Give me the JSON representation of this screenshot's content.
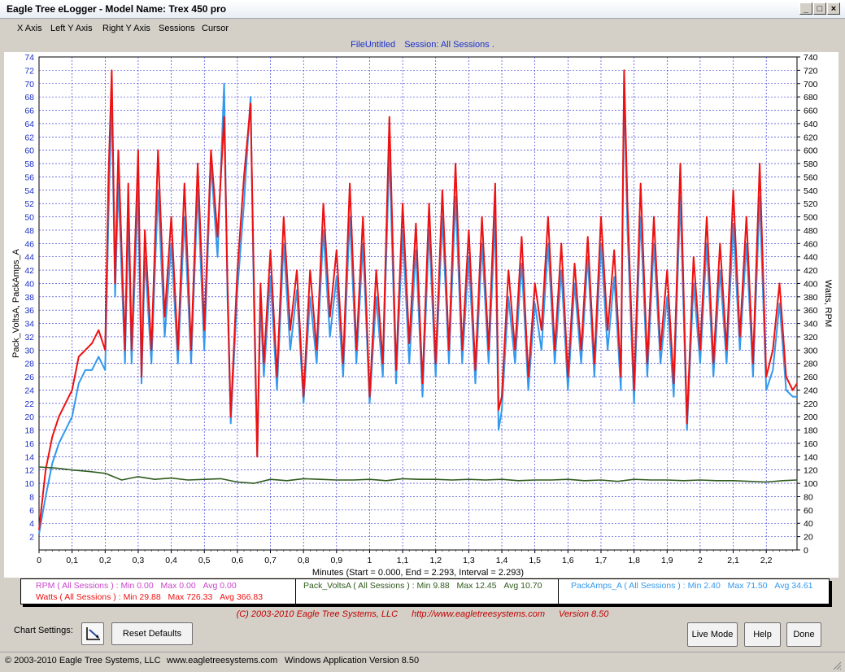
{
  "window": {
    "title": "Eagle Tree eLogger - Model Name: Trex 450 pro"
  },
  "menu": [
    "X Axis",
    "Left Y Axis",
    "Right Y Axis",
    "Sessions",
    "Cursor"
  ],
  "header": {
    "file": "FileUntitled",
    "session": "Session: All Sessions ."
  },
  "legend": {
    "rpm": {
      "label": "RPM ( All Sessions ) :",
      "min": "Min 0.00",
      "max": "Max 0.00",
      "avg": "Avg 0.00"
    },
    "watts": {
      "label": "Watts ( All Sessions ) :",
      "min": "Min 29.88",
      "max": "Max 726.33",
      "avg": "Avg 366.83"
    },
    "volts": {
      "label": "Pack_VoltsA ( All Sessions ) :",
      "min": "Min 9.88",
      "max": "Max 12.45",
      "avg": "Avg 10.70"
    },
    "amps": {
      "label": "PackAmps_A ( All Sessions ) :",
      "min": "Min 2.40",
      "max": "Max 71.50",
      "avg": "Avg 34.61"
    }
  },
  "footer": {
    "copyright": "(C) 2003-2010 Eagle Tree Systems, LLC",
    "url": "http://www.eagletreesystems.com",
    "version": "Version 8.50"
  },
  "controls": {
    "chart_settings": "Chart Settings:",
    "reset": "Reset Defaults",
    "live": "Live Mode",
    "help": "Help",
    "done": "Done"
  },
  "statusbar": {
    "company": "© 2003-2010 Eagle Tree Systems, LLC",
    "site": "www.eagletreesystems.com",
    "app": "Windows Application Version 8.50"
  },
  "colors": {
    "rpm": "#cc44cc",
    "watts": "#ee1111",
    "volts": "#2e5a1c",
    "amps": "#3399ee",
    "grid": "#1f1fd0",
    "axis_text": "#1a2fc8"
  },
  "chart_data": {
    "type": "line",
    "xlabel": "Minutes (Start = 0.000,  End = 2.293,  Interval =  2.293)",
    "ylabel_left": "Pack_VoltsA, PackAmps_A",
    "ylabel_right": "Watts, RPM",
    "xlim": [
      0,
      2.293
    ],
    "ylim_left": [
      0,
      74
    ],
    "ylim_right": [
      0,
      740
    ],
    "x_ticks": [
      "0",
      "0,1",
      "0,2",
      "0,3",
      "0,4",
      "0,5",
      "0,6",
      "0,7",
      "0,8",
      "0,9",
      "1",
      "1,1",
      "1,2",
      "1,3",
      "1,4",
      "1,5",
      "1,6",
      "1,7",
      "1,8",
      "1,9",
      "2",
      "2,1",
      "2,2"
    ],
    "grid": true,
    "series": [
      {
        "name": "Watts",
        "axis": "right",
        "x": [
          0,
          0.02,
          0.04,
          0.06,
          0.08,
          0.1,
          0.12,
          0.14,
          0.16,
          0.18,
          0.2,
          0.21,
          0.22,
          0.23,
          0.24,
          0.26,
          0.27,
          0.28,
          0.3,
          0.31,
          0.32,
          0.34,
          0.36,
          0.38,
          0.4,
          0.42,
          0.44,
          0.46,
          0.48,
          0.5,
          0.52,
          0.54,
          0.56,
          0.57,
          0.58,
          0.6,
          0.62,
          0.64,
          0.65,
          0.66,
          0.67,
          0.68,
          0.7,
          0.72,
          0.74,
          0.76,
          0.78,
          0.8,
          0.82,
          0.84,
          0.86,
          0.88,
          0.9,
          0.92,
          0.94,
          0.96,
          0.98,
          1,
          1.02,
          1.04,
          1.06,
          1.08,
          1.1,
          1.12,
          1.14,
          1.16,
          1.18,
          1.2,
          1.22,
          1.24,
          1.26,
          1.28,
          1.3,
          1.32,
          1.34,
          1.36,
          1.38,
          1.39,
          1.4,
          1.42,
          1.44,
          1.46,
          1.48,
          1.5,
          1.52,
          1.54,
          1.56,
          1.58,
          1.6,
          1.62,
          1.64,
          1.66,
          1.68,
          1.7,
          1.72,
          1.74,
          1.76,
          1.77,
          1.78,
          1.8,
          1.82,
          1.84,
          1.86,
          1.88,
          1.9,
          1.92,
          1.94,
          1.96,
          1.98,
          2,
          2.02,
          2.04,
          2.06,
          2.08,
          2.1,
          2.12,
          2.14,
          2.16,
          2.18,
          2.2,
          2.22,
          2.24,
          2.26,
          2.28,
          2.293
        ],
        "y": [
          30,
          120,
          170,
          200,
          220,
          240,
          290,
          300,
          310,
          330,
          300,
          560,
          720,
          400,
          600,
          300,
          550,
          300,
          600,
          260,
          480,
          300,
          600,
          350,
          500,
          300,
          550,
          300,
          580,
          330,
          600,
          470,
          650,
          400,
          200,
          420,
          560,
          670,
          400,
          140,
          400,
          280,
          450,
          260,
          500,
          330,
          420,
          230,
          420,
          300,
          520,
          350,
          450,
          280,
          550,
          300,
          500,
          230,
          420,
          280,
          650,
          270,
          520,
          310,
          490,
          250,
          520,
          280,
          540,
          300,
          580,
          300,
          480,
          270,
          500,
          300,
          550,
          210,
          230,
          420,
          300,
          470,
          260,
          400,
          330,
          500,
          300,
          460,
          260,
          430,
          300,
          470,
          280,
          500,
          330,
          450,
          260,
          720,
          520,
          240,
          550,
          280,
          500,
          300,
          420,
          250,
          580,
          190,
          440,
          300,
          500,
          280,
          460,
          300,
          540,
          320,
          500,
          280,
          580,
          260,
          300,
          400,
          260,
          240,
          250
        ]
      },
      {
        "name": "PackAmps_A",
        "axis": "left",
        "x": [
          0,
          0.02,
          0.04,
          0.06,
          0.08,
          0.1,
          0.12,
          0.14,
          0.16,
          0.18,
          0.2,
          0.21,
          0.22,
          0.23,
          0.24,
          0.26,
          0.27,
          0.28,
          0.3,
          0.31,
          0.32,
          0.34,
          0.36,
          0.38,
          0.4,
          0.42,
          0.44,
          0.46,
          0.48,
          0.5,
          0.52,
          0.54,
          0.56,
          0.57,
          0.58,
          0.6,
          0.62,
          0.64,
          0.65,
          0.66,
          0.67,
          0.68,
          0.7,
          0.72,
          0.74,
          0.76,
          0.78,
          0.8,
          0.82,
          0.84,
          0.86,
          0.88,
          0.9,
          0.92,
          0.94,
          0.96,
          0.98,
          1,
          1.02,
          1.04,
          1.06,
          1.08,
          1.1,
          1.12,
          1.14,
          1.16,
          1.18,
          1.2,
          1.22,
          1.24,
          1.26,
          1.28,
          1.3,
          1.32,
          1.34,
          1.36,
          1.38,
          1.39,
          1.4,
          1.42,
          1.44,
          1.46,
          1.48,
          1.5,
          1.52,
          1.54,
          1.56,
          1.58,
          1.6,
          1.62,
          1.64,
          1.66,
          1.68,
          1.7,
          1.72,
          1.74,
          1.76,
          1.77,
          1.78,
          1.8,
          1.82,
          1.84,
          1.86,
          1.88,
          1.9,
          1.92,
          1.94,
          1.96,
          1.98,
          2,
          2.02,
          2.04,
          2.06,
          2.08,
          2.1,
          2.12,
          2.14,
          2.16,
          2.18,
          2.2,
          2.22,
          2.24,
          2.26,
          2.28,
          2.293
        ],
        "y": [
          2.4,
          8,
          13,
          16,
          18,
          20,
          25,
          27,
          27,
          29,
          27,
          50,
          68,
          38,
          55,
          28,
          50,
          28,
          54,
          25,
          44,
          28,
          54,
          32,
          46,
          28,
          50,
          28,
          54,
          30,
          58,
          44,
          70,
          38,
          19,
          39,
          52,
          68,
          37,
          14,
          37,
          26,
          41,
          24,
          46,
          30,
          39,
          22,
          38,
          28,
          48,
          32,
          41,
          26,
          50,
          28,
          46,
          22,
          38,
          26,
          60,
          25,
          48,
          28,
          45,
          23,
          48,
          26,
          50,
          28,
          53,
          28,
          44,
          25,
          46,
          28,
          50,
          18,
          21,
          38,
          28,
          43,
          24,
          37,
          30,
          46,
          28,
          42,
          24,
          40,
          28,
          44,
          26,
          46,
          30,
          41,
          24,
          70,
          48,
          22,
          50,
          26,
          46,
          28,
          38,
          23,
          53,
          18,
          40,
          28,
          46,
          26,
          42,
          28,
          49,
          30,
          46,
          26,
          53,
          24,
          27,
          37,
          24,
          23,
          23
        ]
      },
      {
        "name": "Pack_VoltsA",
        "axis": "left",
        "x": [
          0,
          0.05,
          0.1,
          0.15,
          0.2,
          0.25,
          0.3,
          0.35,
          0.4,
          0.45,
          0.5,
          0.55,
          0.6,
          0.65,
          0.7,
          0.75,
          0.8,
          0.85,
          0.9,
          0.95,
          1,
          1.05,
          1.1,
          1.15,
          1.2,
          1.25,
          1.3,
          1.35,
          1.4,
          1.45,
          1.5,
          1.55,
          1.6,
          1.65,
          1.7,
          1.75,
          1.8,
          1.85,
          1.9,
          1.95,
          2,
          2.05,
          2.1,
          2.15,
          2.2,
          2.25,
          2.293
        ],
        "y": [
          12.45,
          12.3,
          12.0,
          11.8,
          11.5,
          10.5,
          11.0,
          10.6,
          10.8,
          10.5,
          10.6,
          10.7,
          10.2,
          10.0,
          10.6,
          10.4,
          10.7,
          10.6,
          10.5,
          10.5,
          10.6,
          10.4,
          10.7,
          10.6,
          10.6,
          10.5,
          10.6,
          10.5,
          10.6,
          10.4,
          10.5,
          10.5,
          10.6,
          10.4,
          10.5,
          10.3,
          10.6,
          10.5,
          10.5,
          10.4,
          10.5,
          10.4,
          10.4,
          10.3,
          10.2,
          10.4,
          10.5
        ]
      }
    ]
  }
}
